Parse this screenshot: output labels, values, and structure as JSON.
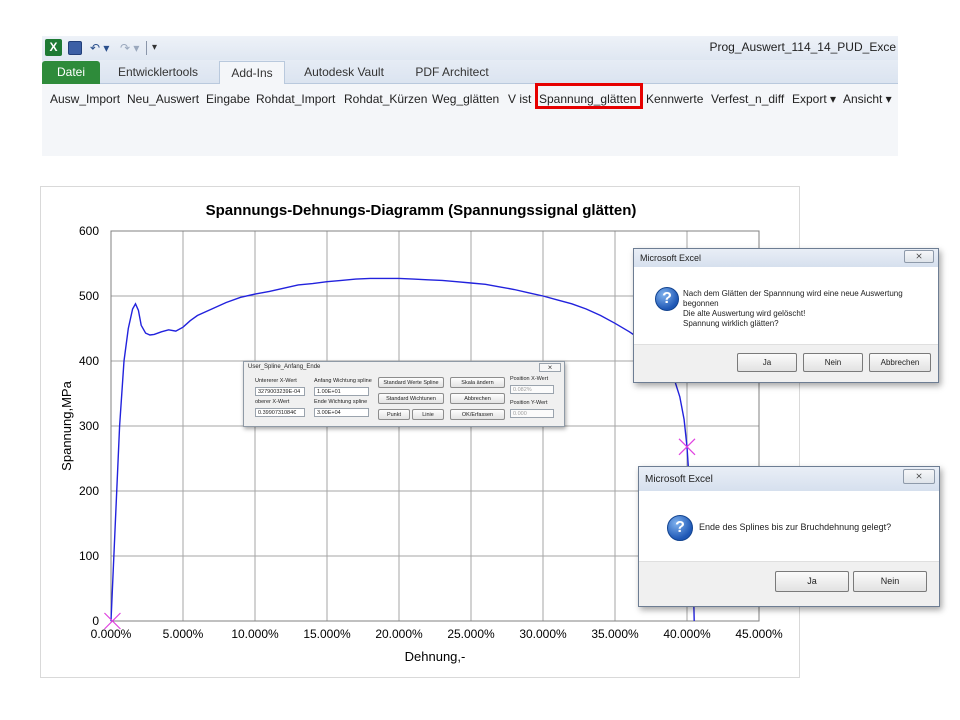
{
  "app": {
    "window_title": "Prog_Auswert_114_14_PUD_Exce",
    "icon": "excel-icon"
  },
  "quick_access": {
    "save": "save-icon",
    "undo": "↶ ▾",
    "redo": "↷ ▾",
    "customize": "▾"
  },
  "tabs": [
    {
      "label": "Datei"
    },
    {
      "label": "Entwicklertools"
    },
    {
      "label": "Add-Ins"
    },
    {
      "label": "Autodesk Vault"
    },
    {
      "label": "PDF Architect"
    }
  ],
  "commands": [
    {
      "label": "Ausw_Import"
    },
    {
      "label": "Neu_Auswert"
    },
    {
      "label": "Eingabe"
    },
    {
      "label": "Rohdat_Import"
    },
    {
      "label": "Rohdat_Kürzen"
    },
    {
      "label": "Weg_glätten"
    },
    {
      "label": "V ist"
    },
    {
      "label": "Spannung_glätten"
    },
    {
      "label": "Kennwerte"
    },
    {
      "label": "Verfest_n_diff"
    },
    {
      "label": "Export ▾"
    },
    {
      "label": "Ansicht ▾"
    }
  ],
  "highlight_color": "#e60000",
  "chart_data": {
    "type": "line",
    "title": "Spannungs-Dehnungs-Diagramm (Spannungssignal glätten)",
    "xlabel": "Dehnung,-",
    "ylabel": "Spannung,MPa",
    "xlim": [
      0,
      0.45
    ],
    "ylim": [
      0,
      600
    ],
    "x_ticks": [
      "0.000%",
      "5.000%",
      "10.000%",
      "15.000%",
      "20.000%",
      "25.000%",
      "30.000%",
      "35.000%",
      "40.000%",
      "45.000%"
    ],
    "y_ticks": [
      "0",
      "100",
      "200",
      "300",
      "400",
      "500",
      "600"
    ],
    "grid": true,
    "line_color": "#2222dd",
    "marker_color": "#e040e0",
    "series": [
      {
        "x": [
          0,
          0.003,
          0.006,
          0.009,
          0.012,
          0.015,
          0.017,
          0.019,
          0.021,
          0.024,
          0.027,
          0.03,
          0.035,
          0.04,
          0.045,
          0.05,
          0.055,
          0.06,
          0.07,
          0.08,
          0.09,
          0.1,
          0.11,
          0.12,
          0.13,
          0.14,
          0.15,
          0.16,
          0.17,
          0.18,
          0.19,
          0.2,
          0.21,
          0.22,
          0.23,
          0.24,
          0.25,
          0.26,
          0.27,
          0.28,
          0.29,
          0.3,
          0.31,
          0.32,
          0.33,
          0.34,
          0.35,
          0.36,
          0.37,
          0.38,
          0.39,
          0.395,
          0.398,
          0.4,
          0.402,
          0.404,
          0.405
        ],
        "y": [
          0,
          150,
          300,
          400,
          450,
          480,
          488,
          478,
          455,
          443,
          440,
          441,
          445,
          448,
          446,
          452,
          462,
          470,
          480,
          490,
          498,
          503,
          507,
          512,
          517,
          519,
          522,
          524,
          526,
          527,
          527,
          527,
          526,
          525,
          524,
          522,
          520,
          518,
          514,
          510,
          505,
          500,
          494,
          488,
          480,
          470,
          458,
          445,
          430,
          410,
          380,
          345,
          310,
          268,
          200,
          100,
          0
        ]
      }
    ],
    "markers": [
      {
        "x": 0.001,
        "y": 0
      },
      {
        "x": 0.4,
        "y": 268
      }
    ]
  },
  "userform": {
    "title": "User_Spline_Anfang_Ende",
    "close": "⨯",
    "lower_x_label": "Untererer X-Wert",
    "lower_x_value": "3279003239E-04",
    "upper_x_label": "oberer X-Wert",
    "upper_x_value": "0.3990731084€",
    "start_weight_label": "Anfang Wichtung spline",
    "start_weight_value": "1.00E+01",
    "end_weight_label": "Ende Wichtung spline",
    "end_weight_value": "3.00E+04",
    "btn_standard_spline": "Standard  Werte  Spline",
    "btn_standard_weights": "Standard Wichtunen",
    "btn_point": "Punkt",
    "btn_line": "Linie",
    "btn_scale": "Skala ändern",
    "btn_cancel": "Abbrechen",
    "btn_ok": "OK/Erfassen",
    "pos_x_label": "Position  X-Wert",
    "pos_x_value": "0.082%",
    "pos_y_label": "Position Y-Wert",
    "pos_y_value": "0.000"
  },
  "msgbox1": {
    "title": "Microsoft Excel",
    "close": "⨯",
    "icon": "question-icon",
    "line1": "Nach dem Glätten der Spannnung wird eine neue Auswertung",
    "line2": "begonnen",
    "line3": "Die alte Auswertung wird gelöscht!",
    "line4": "Spannung wirklich glätten?",
    "btn_yes": "Ja",
    "btn_no": "Nein",
    "btn_cancel": "Abbrechen"
  },
  "msgbox2": {
    "title": "Microsoft Excel",
    "close": "⨯",
    "icon": "question-icon",
    "text": "Ende des Splines bis zur Bruchdehnung gelegt?",
    "btn_yes": "Ja",
    "btn_no": "Nein"
  }
}
